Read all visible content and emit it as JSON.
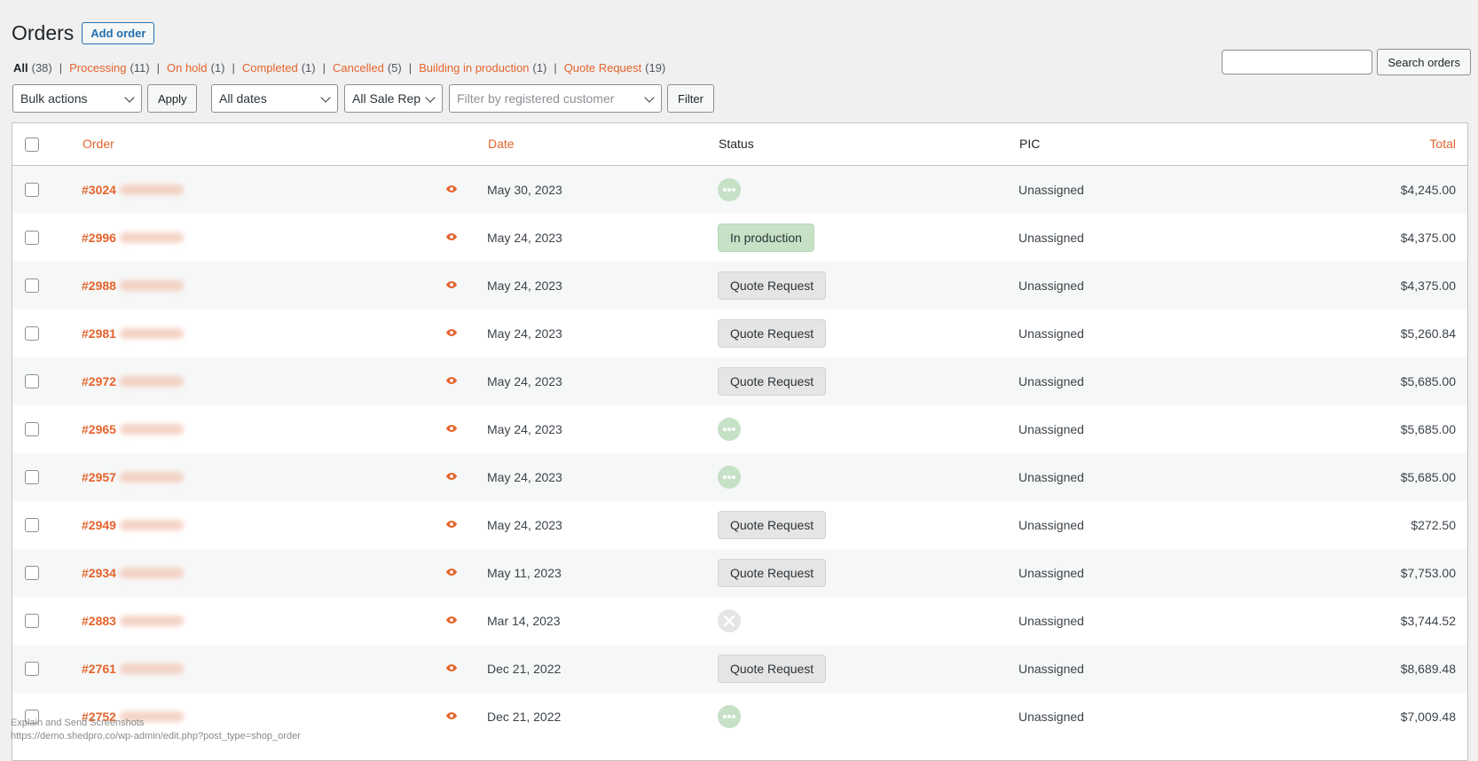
{
  "header": {
    "title": "Orders",
    "add_label": "Add order"
  },
  "filters_status": [
    {
      "label": "All",
      "count": "(38)",
      "current": true
    },
    {
      "label": "Processing",
      "count": "(11)"
    },
    {
      "label": "On hold",
      "count": "(1)"
    },
    {
      "label": "Completed",
      "count": "(1)"
    },
    {
      "label": "Cancelled",
      "count": "(5)"
    },
    {
      "label": "Building in production",
      "count": "(1)"
    },
    {
      "label": "Quote Request",
      "count": "(19)"
    }
  ],
  "search": {
    "value": "",
    "button": "Search orders"
  },
  "toolbar": {
    "bulk_actions": "Bulk actions",
    "apply": "Apply",
    "dates": "All dates",
    "sale_rep": "All Sale Rep",
    "customer_placeholder": "Filter by registered customer",
    "filter": "Filter"
  },
  "columns": {
    "order": "Order",
    "date": "Date",
    "status": "Status",
    "pic": "PIC",
    "total": "Total"
  },
  "colors": {
    "accent": "#e4642c",
    "production": "#c6e1c6",
    "quote": "#e5e5e5"
  },
  "orders": [
    {
      "id": "#3024",
      "date": "May 30, 2023",
      "status_type": "dots",
      "status": "",
      "pic": "Unassigned",
      "total": "$4,245.00"
    },
    {
      "id": "#2996",
      "date": "May 24, 2023",
      "status_type": "production",
      "status": "In production",
      "pic": "Unassigned",
      "total": "$4,375.00"
    },
    {
      "id": "#2988",
      "date": "May 24, 2023",
      "status_type": "quote",
      "status": "Quote Request",
      "pic": "Unassigned",
      "total": "$4,375.00"
    },
    {
      "id": "#2981",
      "date": "May 24, 2023",
      "status_type": "quote",
      "status": "Quote Request",
      "pic": "Unassigned",
      "total": "$5,260.84"
    },
    {
      "id": "#2972",
      "date": "May 24, 2023",
      "status_type": "quote",
      "status": "Quote Request",
      "pic": "Unassigned",
      "total": "$5,685.00"
    },
    {
      "id": "#2965",
      "date": "May 24, 2023",
      "status_type": "dots",
      "status": "",
      "pic": "Unassigned",
      "total": "$5,685.00"
    },
    {
      "id": "#2957",
      "date": "May 24, 2023",
      "status_type": "dots",
      "status": "",
      "pic": "Unassigned",
      "total": "$5,685.00"
    },
    {
      "id": "#2949",
      "date": "May 24, 2023",
      "status_type": "quote",
      "status": "Quote Request",
      "pic": "Unassigned",
      "total": "$272.50"
    },
    {
      "id": "#2934",
      "date": "May 11, 2023",
      "status_type": "quote",
      "status": "Quote Request",
      "pic": "Unassigned",
      "total": "$7,753.00"
    },
    {
      "id": "#2883",
      "date": "Mar 14, 2023",
      "status_type": "cancelled",
      "status": "",
      "pic": "Unassigned",
      "total": "$3,744.52"
    },
    {
      "id": "#2761",
      "date": "Dec 21, 2022",
      "status_type": "quote",
      "status": "Quote Request",
      "pic": "Unassigned",
      "total": "$8,689.48"
    },
    {
      "id": "#2752",
      "date": "Dec 21, 2022",
      "status_type": "dots",
      "status": "",
      "pic": "Unassigned",
      "total": "$7,009.48"
    }
  ],
  "status_bar": {
    "line1": "Explain and Send Screenshots",
    "line2": "https://demo.shedpro.co/wp-admin/edit.php?post_type=shop_order"
  }
}
